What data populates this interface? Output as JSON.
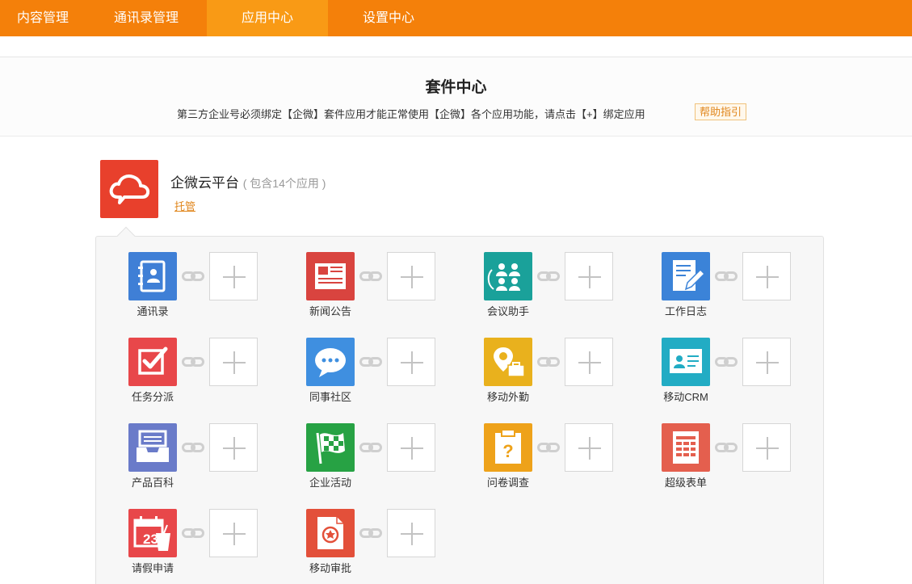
{
  "nav": {
    "tabs": [
      {
        "label": "内容管理",
        "active": false
      },
      {
        "label": "通讯录管理",
        "active": false
      },
      {
        "label": "应用中心",
        "active": true
      },
      {
        "label": "设置中心",
        "active": false
      }
    ]
  },
  "header": {
    "title": "套件中心",
    "description": "第三方企业号必须绑定【企微】套件应用才能正常使用【企微】各个应用功能，请点击【+】绑定应用",
    "help_label": "帮助指引"
  },
  "suite": {
    "name": "企微云平台",
    "count_text": "( 包含14个应用 )",
    "host_label": "托管"
  },
  "apps": [
    {
      "label": "通讯录",
      "color": "#3f7fd6",
      "icon": "address-book-icon"
    },
    {
      "label": "新闻公告",
      "color": "#d9443f",
      "icon": "newspaper-icon"
    },
    {
      "label": "会议助手",
      "color": "#1aa19a",
      "icon": "meeting-icon"
    },
    {
      "label": "工作日志",
      "color": "#3b83d8",
      "icon": "log-edit-icon"
    },
    {
      "label": "任务分派",
      "color": "#e8474a",
      "icon": "task-check-icon"
    },
    {
      "label": "同事社区",
      "color": "#3f8fe0",
      "icon": "chat-bubble-icon"
    },
    {
      "label": "移动外勤",
      "color": "#e9b11d",
      "icon": "location-briefcase-icon"
    },
    {
      "label": "移动CRM",
      "color": "#22acc4",
      "icon": "contact-card-icon"
    },
    {
      "label": "产品百科",
      "color": "#6a7bc9",
      "icon": "inbox-tray-icon"
    },
    {
      "label": "企业活动",
      "color": "#27a244",
      "icon": "checkered-flag-icon"
    },
    {
      "label": "问卷调查",
      "color": "#eea21a",
      "icon": "question-clipboard-icon"
    },
    {
      "label": "超级表单",
      "color": "#e45f4e",
      "icon": "spreadsheet-icon"
    },
    {
      "label": "请假申请",
      "color": "#e8474a",
      "icon": "calendar-cup-icon"
    },
    {
      "label": "移动审批",
      "color": "#e3503a",
      "icon": "approval-stamp-icon"
    }
  ]
}
